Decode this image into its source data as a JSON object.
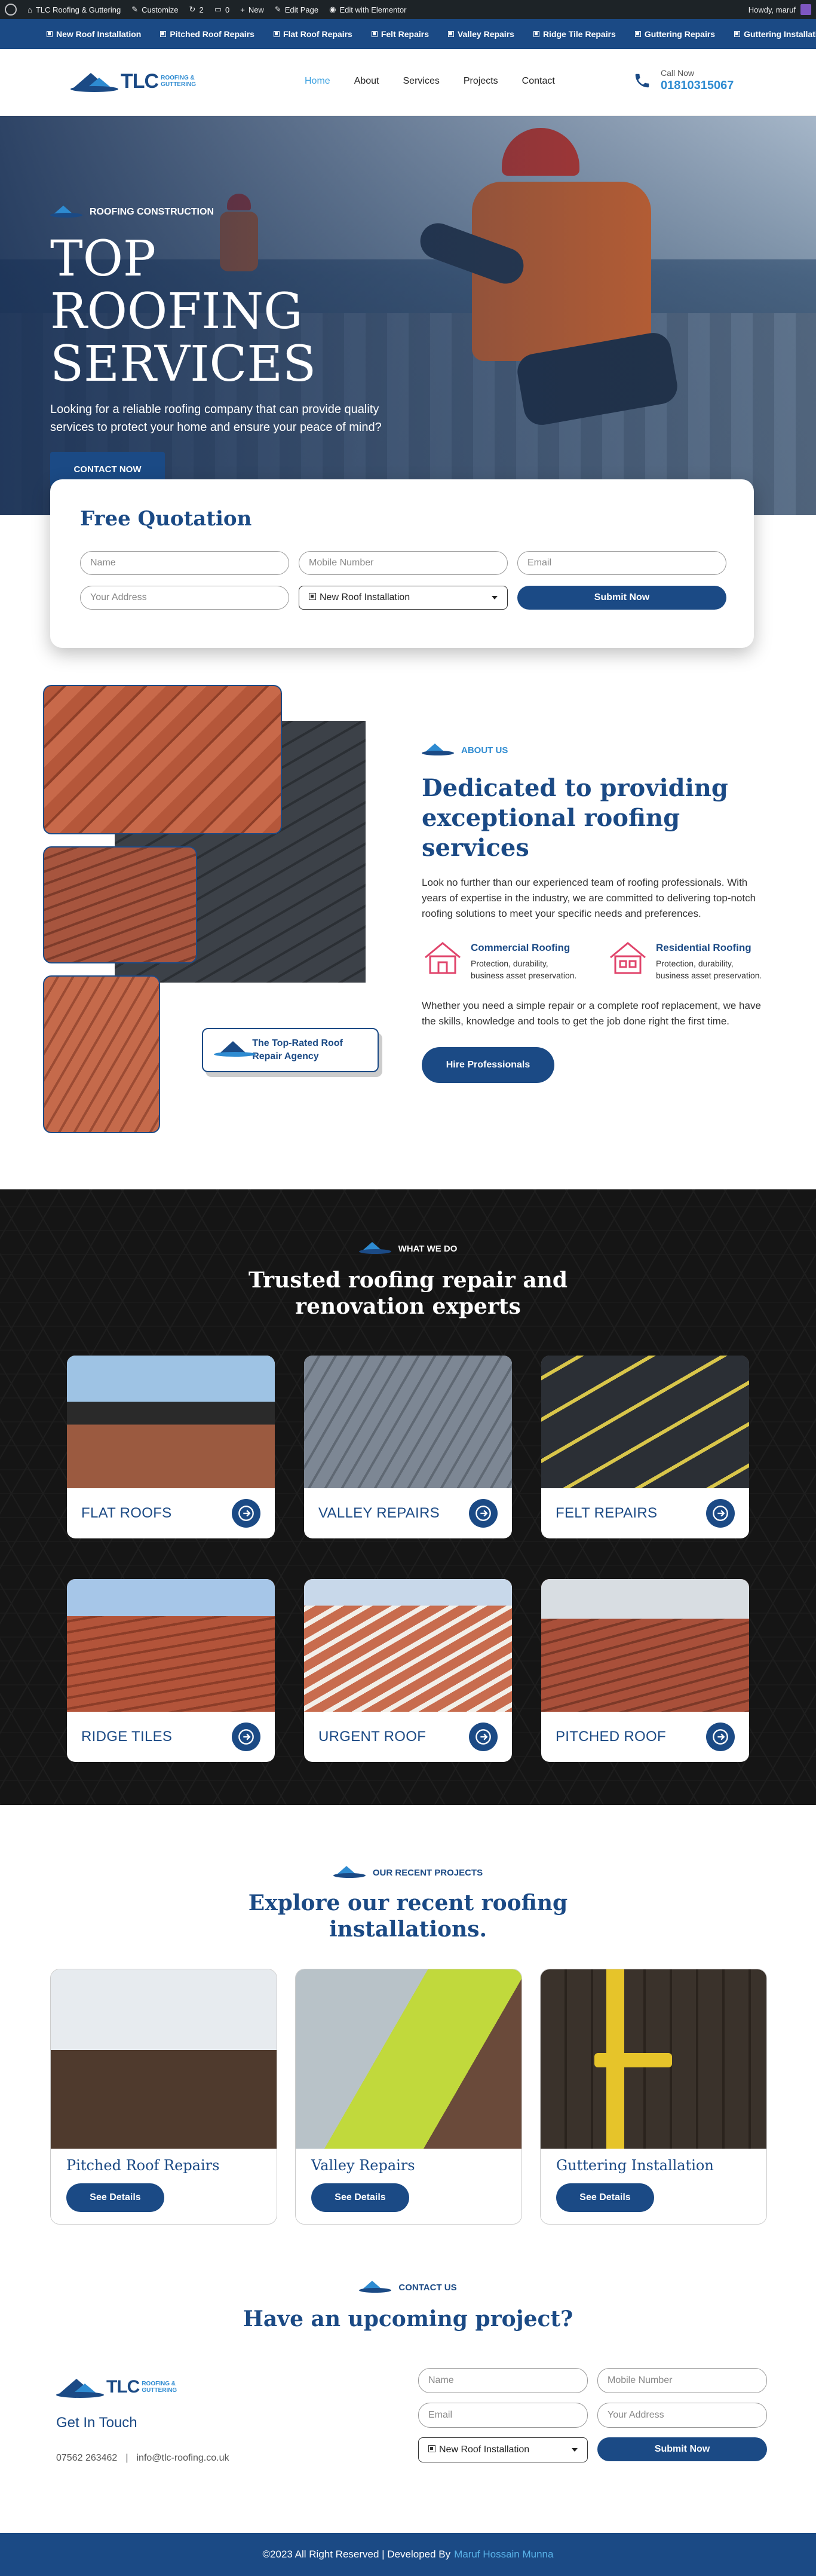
{
  "admin_bar": {
    "site_name": "TLC Roofing & Guttering",
    "customize": "Customize",
    "updates_count": "2",
    "comments_count": "0",
    "new": "New",
    "edit_page": "Edit Page",
    "edit_elementor": "Edit with Elementor",
    "howdy": "Howdy, maruf"
  },
  "top_strip": {
    "items": [
      "New Roof Installation",
      "Pitched Roof Repairs",
      "Flat Roof Repairs",
      "Felt Repairs",
      "Valley Repairs",
      "Ridge Tile Repairs",
      "Guttering Repairs",
      "Guttering Installation"
    ]
  },
  "header": {
    "logo_big": "TLC",
    "logo_small_1": "ROOFING &",
    "logo_small_2": "GUTTERING",
    "nav": [
      "Home",
      "About",
      "Services",
      "Projects",
      "Contact"
    ],
    "call_label": "Call Now",
    "call_number": "01810315067"
  },
  "hero": {
    "eyebrow": "ROOFING CONSTRUCTION",
    "title_line1": "TOP ROOFING",
    "title_line2": "SERVICES",
    "text": "Looking for a reliable roofing company that can provide quality services to protect your home and ensure your peace of mind?",
    "cta": "CONTACT NOW"
  },
  "quote": {
    "title": "Free Quotation",
    "name_placeholder": "Name",
    "mobile_placeholder": "Mobile Number",
    "email_placeholder": "Email",
    "address_placeholder": "Your Address",
    "service_selected": "New Roof Installation",
    "submit": "Submit Now"
  },
  "about": {
    "eyebrow": "ABOUT US",
    "title": "Dedicated to providing exceptional roofing services",
    "lead": "Look no further than our experienced team of roofing professionals. With years of expertise in the industry, we are committed to delivering top-notch roofing solutions to meet your specific needs and preferences.",
    "features": [
      {
        "title": "Commercial Roofing",
        "desc": "Protection, durability, business asset preservation."
      },
      {
        "title": "Residential Roofing",
        "desc": "Protection, durability, business asset preservation."
      }
    ],
    "more": "Whether you need a simple repair or a complete roof replacement, we have the skills, knowledge and tools to get the job done right the first time.",
    "cta": "Hire Professionals",
    "badge": "The Top-Rated Roof Repair Agency"
  },
  "services": {
    "eyebrow": "WHAT WE DO",
    "title_line1": "Trusted roofing repair and",
    "title_line2": "renovation experts",
    "cards": [
      "FLAT ROOFS",
      "VALLEY REPAIRS",
      "FELT REPAIRS",
      "RIDGE TILES",
      "URGENT ROOF",
      "PITCHED ROOF"
    ]
  },
  "projects": {
    "eyebrow": "OUR RECENT PROJECTS",
    "title_line1": "Explore our recent roofing",
    "title_line2": "installations.",
    "cards": [
      {
        "title": "Pitched Roof Repairs",
        "cta": "See Details"
      },
      {
        "title": "Valley Repairs",
        "cta": "See Details"
      },
      {
        "title": "Guttering Installation",
        "cta": "See Details"
      }
    ]
  },
  "contact": {
    "eyebrow": "CONTACT US",
    "title": "Have an upcoming project?",
    "get_in_touch": "Get In Touch",
    "phone": "07562 263462",
    "separator": "|",
    "email": "info@tlc-roofing.co.uk",
    "form": {
      "name_placeholder": "Name",
      "mobile_placeholder": "Mobile Number",
      "email_placeholder": "Email",
      "address_placeholder": "Your Address",
      "service_selected": "New Roof Installation",
      "submit": "Submit Now"
    }
  },
  "footer": {
    "text": "©2023 All Right Reserved | Developed By",
    "author": "Maruf Hossain Munna"
  }
}
